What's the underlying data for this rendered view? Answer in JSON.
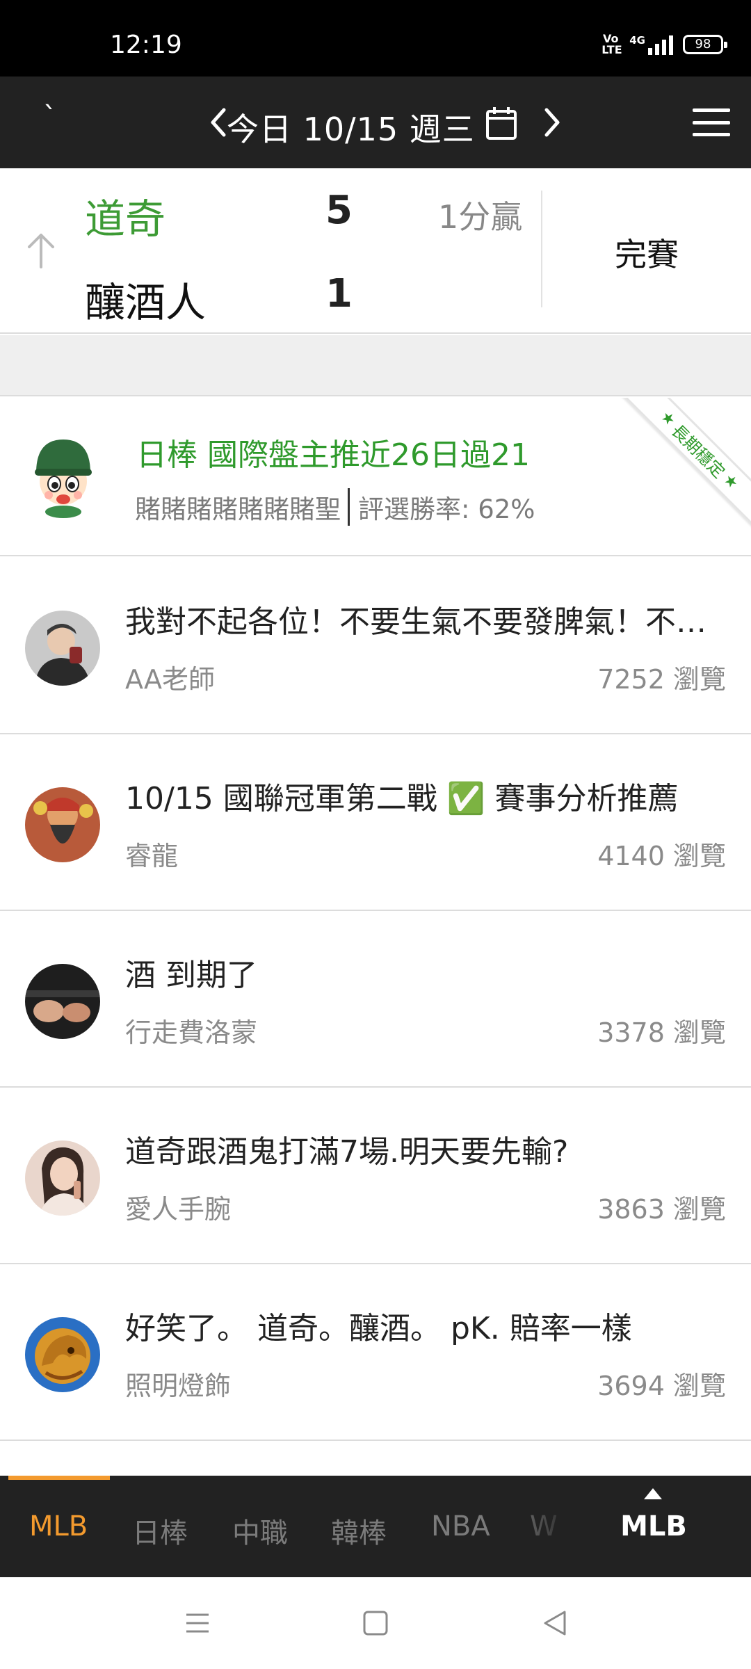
{
  "status_bar": {
    "time": "12:19",
    "volte_label": "Vo LTE",
    "network": "4G",
    "battery": "98"
  },
  "header": {
    "mark": "ˋ",
    "date_label": "今日 10/15 週三",
    "prev_icon": "chevron-left-icon",
    "next_icon": "chevron-right-icon",
    "calendar_icon": "calendar-icon",
    "menu_icon": "hamburger-menu-icon"
  },
  "game": {
    "home_team": "道奇",
    "home_score": "5",
    "away_team": "釀酒人",
    "away_score": "1",
    "margin": "1分贏",
    "status": "完賽",
    "winner_color": "#3d9b35"
  },
  "featured": {
    "title": "日棒 國際盤主推近26日過21",
    "author": "賭賭賭賭賭賭賭聖",
    "win_rate": "評選勝率: 62%",
    "ribbon": "長期穩定",
    "accent_color": "#2f9a2c"
  },
  "posts": [
    {
      "title": "我對不起各位！不要生氣不要發脾氣！不要生氣不要發脾氣",
      "author": "AA老師",
      "views": "7252 瀏覽"
    },
    {
      "title": "10/15 國聯冠軍第二戰 ✅ 賽事分析推薦",
      "author": "睿龍",
      "views": "4140 瀏覽"
    },
    {
      "title": "酒 到期了",
      "author": "行走費洛蒙",
      "views": "3378 瀏覽"
    },
    {
      "title": "道奇跟酒鬼打滿7場.明天要先輸?",
      "author": "愛人手腕",
      "views": "3863 瀏覽"
    },
    {
      "title": "好笑了。 道奇。釀酒。 pK. 賠率一樣",
      "author": "照明燈飾",
      "views": "3694 瀏覽"
    }
  ],
  "tabs": {
    "items": [
      "MLB",
      "日棒",
      "中職",
      "韓棒",
      "NBA",
      "W"
    ],
    "active": "MLB",
    "current": "MLB",
    "accent_color": "#f39a2e"
  },
  "system_nav": {
    "icons": [
      "recent-apps-icon",
      "home-icon",
      "back-icon"
    ]
  }
}
